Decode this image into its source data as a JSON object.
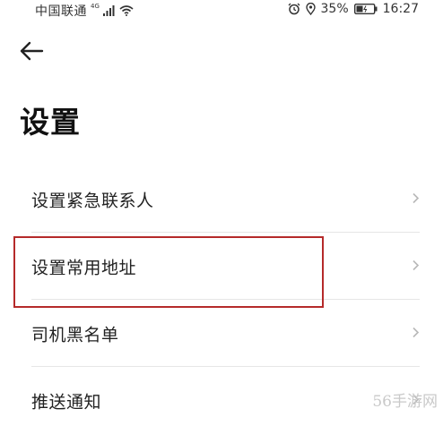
{
  "status_bar": {
    "carrier": "中国联通",
    "network": "4G",
    "battery_percent": "35%",
    "time": "16:27",
    "icons": [
      "signal-icon",
      "wifi-icon",
      "alarm-icon",
      "location-icon",
      "battery-icon"
    ]
  },
  "header": {
    "back_icon": "arrow-left-icon",
    "title": "设置"
  },
  "settings": {
    "items": [
      {
        "label": "设置紧急联系人"
      },
      {
        "label": "设置常用地址"
      },
      {
        "label": "司机黑名单"
      },
      {
        "label": "推送通知"
      }
    ]
  },
  "annotation": {
    "highlight_color": "#b52a2a"
  },
  "watermark": "56手游网"
}
